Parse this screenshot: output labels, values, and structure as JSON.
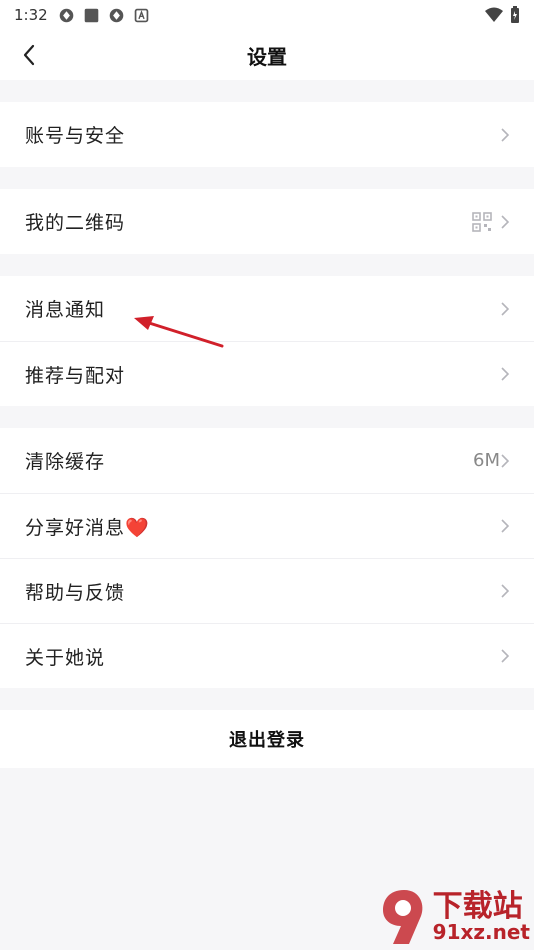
{
  "status_bar": {
    "time": "1:32"
  },
  "header": {
    "title": "设置"
  },
  "groups": [
    {
      "items": [
        {
          "label": "账号与安全"
        }
      ]
    },
    {
      "items": [
        {
          "label": "我的二维码"
        }
      ]
    },
    {
      "items": [
        {
          "label": "消息通知"
        },
        {
          "label": "推荐与配对"
        }
      ]
    },
    {
      "items": [
        {
          "label": "清除缓存",
          "value": "6M"
        },
        {
          "label": "分享好消息❤️"
        },
        {
          "label": "帮助与反馈"
        },
        {
          "label": "关于她说"
        }
      ]
    }
  ],
  "logout": {
    "label": "退出登录"
  },
  "watermark": {
    "top": "下载站",
    "bottom": "91xz.net"
  },
  "colors": {
    "annotation_arrow": "#d1202a"
  }
}
